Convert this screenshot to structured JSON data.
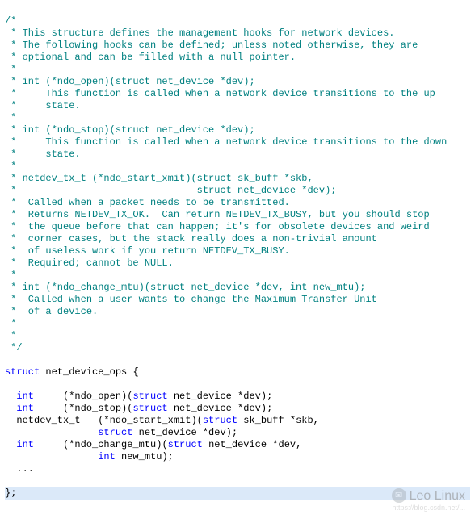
{
  "comment_lines": [
    "/*",
    " * This structure defines the management hooks for network devices.",
    " * The following hooks can be defined; unless noted otherwise, they are",
    " * optional and can be filled with a null pointer.",
    " *",
    " * int (*ndo_open)(struct net_device *dev);",
    " *     This function is called when a network device transitions to the up",
    " *     state.",
    " *",
    " * int (*ndo_stop)(struct net_device *dev);",
    " *     This function is called when a network device transitions to the down",
    " *     state.",
    " *",
    " * netdev_tx_t (*ndo_start_xmit)(struct sk_buff *skb,",
    " *                               struct net_device *dev);",
    " *  Called when a packet needs to be transmitted.",
    " *  Returns NETDEV_TX_OK.  Can return NETDEV_TX_BUSY, but you should stop",
    " *  the queue before that can happen; it's for obsolete devices and weird",
    " *  corner cases, but the stack really does a non-trivial amount",
    " *  of useless work if you return NETDEV_TX_BUSY.",
    " *  Required; cannot be NULL.",
    " *",
    " * int (*ndo_change_mtu)(struct net_device *dev, int new_mtu);",
    " *  Called when a user wants to change the Maximum Transfer Unit",
    " *  of a device.",
    " *",
    " *",
    " */"
  ],
  "struct_header": {
    "kw": "struct",
    "rest": " net_device_ops {"
  },
  "member_lines": [
    [
      {
        "cls": "plain",
        "t": "  "
      },
      {
        "cls": "kw",
        "t": "int"
      },
      {
        "cls": "plain",
        "t": "     (*ndo_open)("
      },
      {
        "cls": "kw",
        "t": "struct"
      },
      {
        "cls": "plain",
        "t": " net_device *dev);"
      }
    ],
    [
      {
        "cls": "plain",
        "t": "  "
      },
      {
        "cls": "kw",
        "t": "int"
      },
      {
        "cls": "plain",
        "t": "     (*ndo_stop)("
      },
      {
        "cls": "kw",
        "t": "struct"
      },
      {
        "cls": "plain",
        "t": " net_device *dev);"
      }
    ],
    [
      {
        "cls": "plain",
        "t": "  netdev_tx_t   (*ndo_start_xmit)("
      },
      {
        "cls": "kw",
        "t": "struct"
      },
      {
        "cls": "plain",
        "t": " sk_buff *skb,"
      }
    ],
    [
      {
        "cls": "plain",
        "t": "                "
      },
      {
        "cls": "kw",
        "t": "struct"
      },
      {
        "cls": "plain",
        "t": " net_device *dev);"
      }
    ],
    [
      {
        "cls": "plain",
        "t": "  "
      },
      {
        "cls": "kw",
        "t": "int"
      },
      {
        "cls": "plain",
        "t": "     (*ndo_change_mtu)("
      },
      {
        "cls": "kw",
        "t": "struct"
      },
      {
        "cls": "plain",
        "t": " net_device *dev,"
      }
    ],
    [
      {
        "cls": "plain",
        "t": "                "
      },
      {
        "cls": "kw",
        "t": "int"
      },
      {
        "cls": "plain",
        "t": " new_mtu);"
      }
    ],
    [
      {
        "cls": "plain",
        "t": "  ..."
      }
    ]
  ],
  "closing": "};",
  "watermark": "Leo Linux",
  "watermark_sub": "https://blog.csdn.net/..."
}
